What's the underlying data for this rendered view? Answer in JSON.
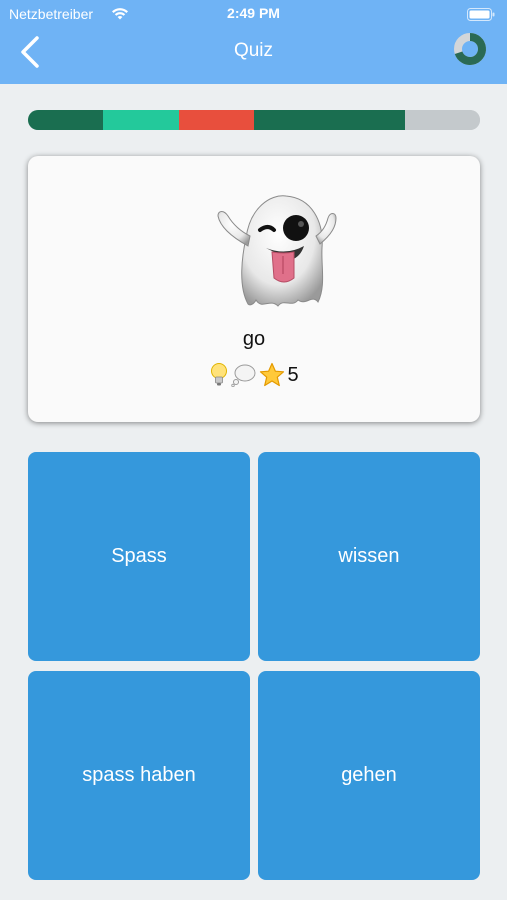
{
  "status_bar": {
    "carrier": "Netzbetreiber",
    "time": "2:49 PM",
    "wifi_icon": "wifi-icon",
    "battery_icon": "battery-icon"
  },
  "nav": {
    "title": "Quiz",
    "back_icon": "chevron-left-icon",
    "progress_icon": "progress-ring-icon",
    "progress_fraction": 0.7
  },
  "progress_bar": {
    "segments": [
      {
        "state": "correct",
        "color": "#1a6e50"
      },
      {
        "state": "current",
        "color": "#23c99b"
      },
      {
        "state": "wrong",
        "color": "#e84f3d"
      },
      {
        "state": "correct",
        "color": "#1a6e50"
      },
      {
        "state": "correct",
        "color": "#1a6e50"
      },
      {
        "state": "pending",
        "color": "#c4c9cc"
      }
    ]
  },
  "card": {
    "emoji_icon": "ghost-icon",
    "word": "go",
    "hints": [
      "lightbulb-icon",
      "thought-bubble-icon",
      "star-icon"
    ],
    "score": "5"
  },
  "answers": [
    {
      "label": "Spass"
    },
    {
      "label": "wissen"
    },
    {
      "label": "spass haben"
    },
    {
      "label": "gehen"
    }
  ],
  "colors": {
    "header": "#6fb3f5",
    "answer_button": "#3598dc",
    "background": "#eceff1"
  }
}
